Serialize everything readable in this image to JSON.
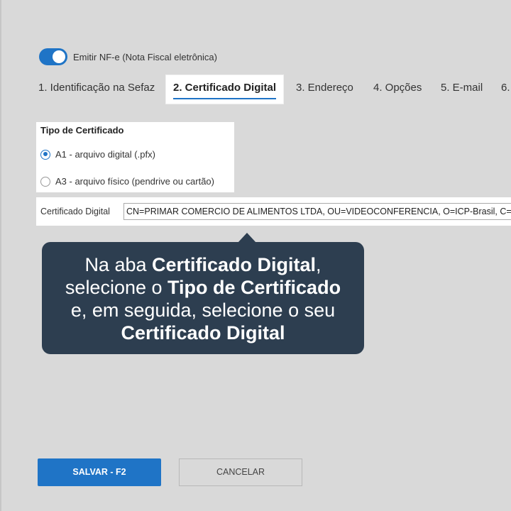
{
  "toggle": {
    "label": "Emitir NF-e (Nota Fiscal eletrônica)",
    "on": true
  },
  "tabs": [
    {
      "label": "1. Identificação na Sefaz"
    },
    {
      "label": "2. Certificado Digital"
    },
    {
      "label": "3. Endereço"
    },
    {
      "label": "4. Opções"
    },
    {
      "label": "5. E-mail"
    },
    {
      "label": "6."
    }
  ],
  "cert_type": {
    "title": "Tipo de Certificado",
    "options": [
      {
        "label": "A1 - arquivo digital (.pfx)",
        "checked": true
      },
      {
        "label": "A3 - arquivo físico (pendrive ou cartão)",
        "checked": false
      }
    ]
  },
  "cert_field": {
    "label": "Certificado Digital",
    "value": "CN=PRIMAR COMERCIO DE ALIMENTOS LTDA, OU=VIDEOCONFERENCIA, O=ICP-Brasil, C=BR"
  },
  "callout": {
    "line1_plain": "Na aba ",
    "line1_bold": "Certificado Digital",
    "line1_end": ",",
    "line2_plain": "selecione o ",
    "line2_bold": "Tipo de Certificado",
    "line3_plain": "e, em seguida, selecione o seu",
    "line4_bold": "Certificado Digital"
  },
  "buttons": {
    "save": "SALVAR - F2",
    "cancel": "CANCELAR"
  },
  "colors": {
    "accent": "#1f74c6",
    "callout_bg": "#2d3e50",
    "page_bg": "#d9d9d9"
  }
}
